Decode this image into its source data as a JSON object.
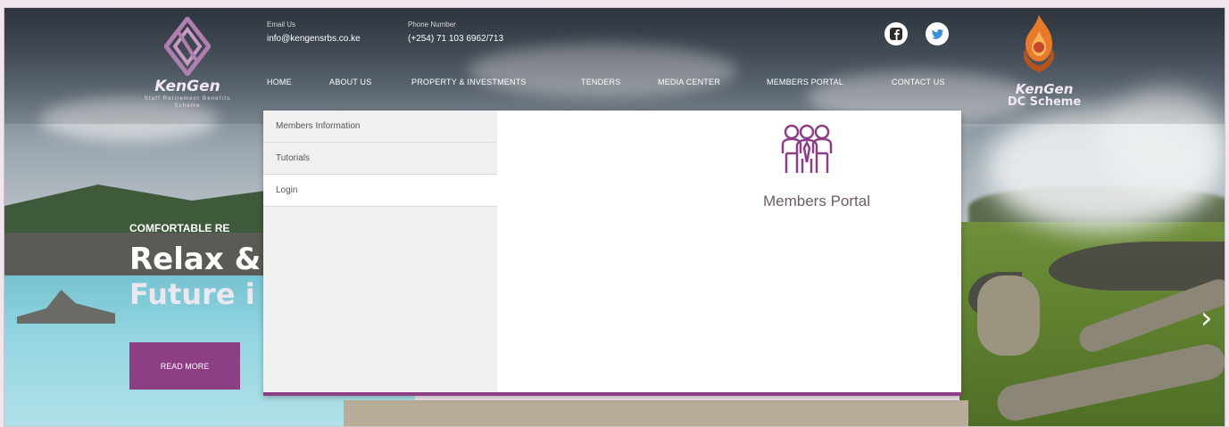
{
  "header": {
    "logo_left": {
      "name": "KenGen",
      "subtitle": "Staff Retirement Benefits Scheme"
    },
    "email": {
      "label": "Email Us",
      "value": "info@kengensrbs.co.ke"
    },
    "phone": {
      "label": "Phone Number",
      "value": "(+254) 71 103 6962/713"
    },
    "social": [
      {
        "name": "facebook-icon",
        "glyph": "f",
        "color": "#2d2d2d"
      },
      {
        "name": "twitter-icon",
        "glyph": "t",
        "color": "#3b8fd6"
      }
    ],
    "logo_right": {
      "name": "KenGen",
      "subtitle": "DC Scheme"
    }
  },
  "nav": {
    "items": [
      "HOME",
      "ABOUT US",
      "PROPERTY & INVESTMENTS",
      "TENDERS",
      "MEDIA CENTER",
      "MEMBERS PORTAL",
      "CONTACT US"
    ]
  },
  "dropdown": {
    "items": [
      {
        "label": "Members Information",
        "active": false
      },
      {
        "label": "Tutorials",
        "active": false
      },
      {
        "label": "Login",
        "active": true
      }
    ],
    "feature_title": "Members Portal",
    "accent": "#8d3f85"
  },
  "hero": {
    "kicker": "COMFORTABLE RE",
    "line1": "Relax &",
    "line2": "Future i",
    "cta": "READ MORE"
  },
  "slider": {
    "next_glyph": "›"
  }
}
